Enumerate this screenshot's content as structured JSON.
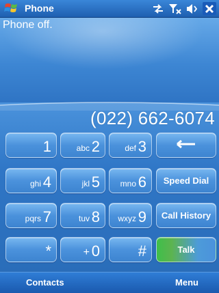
{
  "titlebar": {
    "title": "Phone",
    "icons": [
      "windows-start-icon",
      "connectivity-icon",
      "signal-off-icon",
      "volume-icon",
      "close-icon"
    ]
  },
  "status": "Phone off.",
  "display": {
    "number": "(022) 662-6074"
  },
  "keypad": {
    "k1": {
      "letters": "",
      "digit": "1"
    },
    "k2": {
      "letters": "abc",
      "digit": "2"
    },
    "k3": {
      "letters": "def",
      "digit": "3"
    },
    "k4": {
      "letters": "ghi",
      "digit": "4"
    },
    "k5": {
      "letters": "jkl",
      "digit": "5"
    },
    "k6": {
      "letters": "mno",
      "digit": "6"
    },
    "k7": {
      "letters": "pqrs",
      "digit": "7"
    },
    "k8": {
      "letters": "tuv",
      "digit": "8"
    },
    "k9": {
      "letters": "wxyz",
      "digit": "9"
    },
    "kstar": {
      "letters": "",
      "digit": "*"
    },
    "k0": {
      "letters": "+",
      "digit": "0"
    },
    "khash": {
      "letters": "",
      "digit": "#"
    }
  },
  "buttons": {
    "speed_dial": "Speed Dial",
    "call_history": "Call History",
    "talk": "Talk"
  },
  "softkeys": {
    "left": "Contacts",
    "right": "Menu"
  },
  "colors": {
    "accent": "#2b77c4",
    "talk_green": "#3fbf4a"
  }
}
